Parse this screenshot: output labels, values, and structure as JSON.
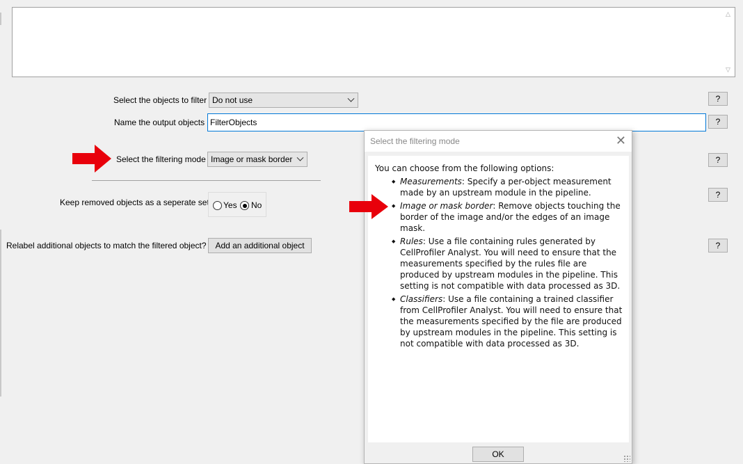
{
  "settings": {
    "objects_to_filter": {
      "label": "Select the objects to filter",
      "value": "Do not use"
    },
    "output_objects": {
      "label": "Name the output objects",
      "value": "FilterObjects"
    },
    "filtering_mode": {
      "label": "Select the filtering mode",
      "value": "Image or mask border"
    },
    "keep_removed": {
      "label": "Keep removed objects as a seperate set?",
      "yes_label": "Yes",
      "no_label": "No",
      "selected": "No"
    },
    "relabel": {
      "label": "Relabel additional objects to match the filtered object?",
      "button_label": "Add an additional object"
    },
    "help_label": "?"
  },
  "dialog": {
    "title": "Select the filtering mode",
    "intro": "You can choose from the following options:",
    "options": [
      {
        "term": "Measurements",
        "text": ": Specify a per-object measurement made by an upstream module in the pipeline."
      },
      {
        "term": "Image or mask border",
        "text": ": Remove objects touching the border of the image and/or the edges of an image mask."
      },
      {
        "term": "Rules",
        "text": ": Use a file containing rules generated by CellProfiler Analyst. You will need to ensure that the measurements specified by the rules file are produced by upstream modules in the pipeline. This setting is not compatible with data processed as 3D."
      },
      {
        "term": "Classifiers",
        "text": ": Use a file containing a trained classifier from CellProfiler Analyst. You will need to ensure that the measurements specified by the file are produced by upstream modules in the pipeline. This setting is not compatible with data processed as 3D."
      }
    ],
    "ok_label": "OK",
    "close_glyph": "✕"
  },
  "colors": {
    "annotation_arrow": "#e8000b",
    "focus_border": "#0078d7",
    "window_bg": "#f0f0f0"
  }
}
